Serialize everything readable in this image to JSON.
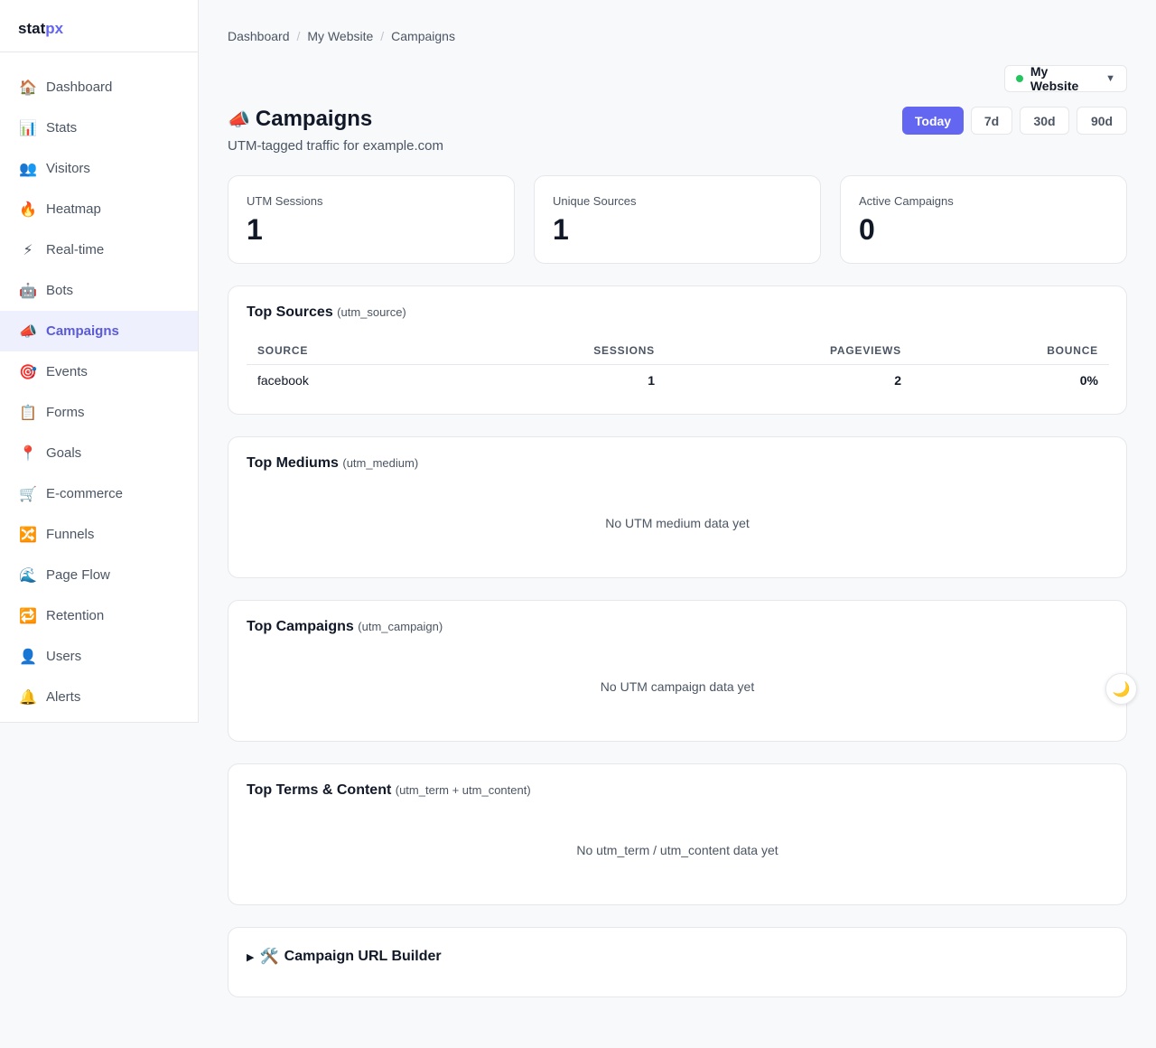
{
  "brand": {
    "part1": "stat",
    "part2": "px"
  },
  "sidebar": {
    "items": [
      {
        "label": "Dashboard",
        "icon": "🏠"
      },
      {
        "label": "Stats",
        "icon": "📊"
      },
      {
        "label": "Visitors",
        "icon": "👥"
      },
      {
        "label": "Heatmap",
        "icon": "🔥"
      },
      {
        "label": "Real-time",
        "icon": "⚡"
      },
      {
        "label": "Bots",
        "icon": "🤖"
      },
      {
        "label": "Campaigns",
        "icon": "📣"
      },
      {
        "label": "Events",
        "icon": "🎯"
      },
      {
        "label": "Forms",
        "icon": "📋"
      },
      {
        "label": "Goals",
        "icon": "📍"
      },
      {
        "label": "E-commerce",
        "icon": "🛒"
      },
      {
        "label": "Funnels",
        "icon": "🔀"
      },
      {
        "label": "Page Flow",
        "icon": "🌊"
      },
      {
        "label": "Retention",
        "icon": "🔁"
      },
      {
        "label": "Users",
        "icon": "👤"
      },
      {
        "label": "Alerts",
        "icon": "🔔"
      }
    ],
    "active": "Campaigns"
  },
  "breadcrumb": [
    "Dashboard",
    "My Website",
    "Campaigns"
  ],
  "site_select": {
    "value": "My Website",
    "status_color": "#22c55e"
  },
  "header": {
    "icon": "📣",
    "title": "Campaigns",
    "subtitle": "UTM-tagged traffic for example.com"
  },
  "ranges": {
    "items": [
      "Today",
      "7d",
      "30d",
      "90d"
    ],
    "active": "Today"
  },
  "stats": [
    {
      "label": "UTM Sessions",
      "value": "1"
    },
    {
      "label": "Unique Sources",
      "value": "1"
    },
    {
      "label": "Active Campaigns",
      "value": "0"
    }
  ],
  "sources": {
    "title": "Top Sources",
    "tag": "(utm_source)",
    "columns": [
      "SOURCE",
      "SESSIONS",
      "PAGEVIEWS",
      "BOUNCE"
    ],
    "rows": [
      {
        "source": "facebook",
        "sessions": "1",
        "pageviews": "2",
        "bounce": "0%"
      }
    ]
  },
  "mediums": {
    "title": "Top Mediums",
    "tag": "(utm_medium)",
    "empty": "No UTM medium data yet"
  },
  "campaigns": {
    "title": "Top Campaigns",
    "tag": "(utm_campaign)",
    "empty": "No UTM campaign data yet"
  },
  "terms": {
    "title": "Top Terms & Content",
    "tag": "(utm_term + utm_content)",
    "empty": "No utm_term / utm_content data yet"
  },
  "builder": {
    "toggle": "▶",
    "icon": "🛠️",
    "label": "Campaign URL Builder"
  },
  "theme_toggle": {
    "icon": "🌙"
  },
  "colors": {
    "accent": "#6366f1",
    "active_bg": "#eef0fe",
    "online": "#22c55e"
  }
}
